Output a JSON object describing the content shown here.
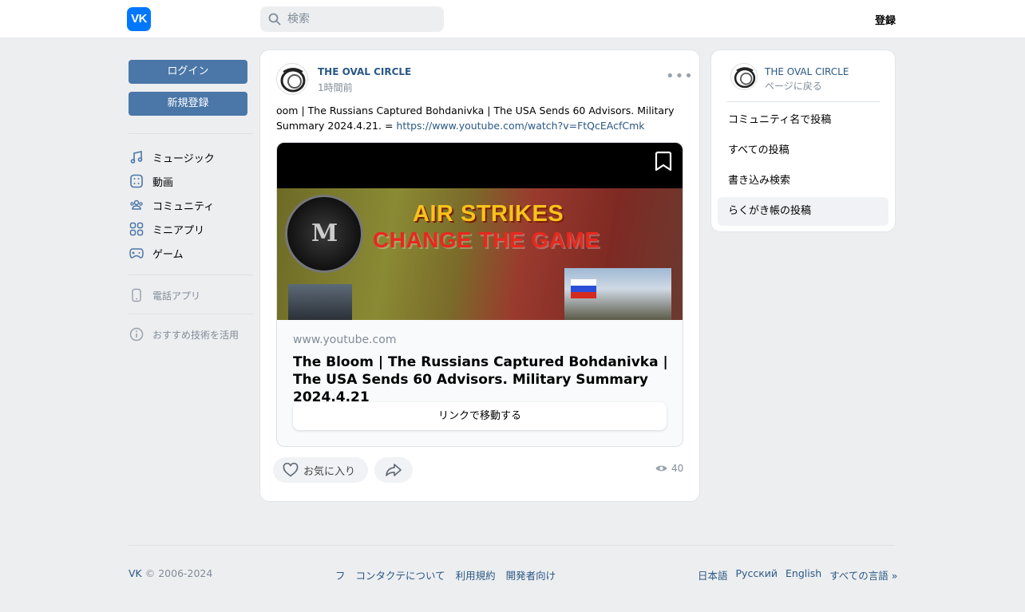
{
  "header": {
    "logo_text": "VK",
    "search_placeholder": "検索",
    "register_label": "登録"
  },
  "left_nav": {
    "login_label": "ログイン",
    "signup_label": "新規登録",
    "items": [
      {
        "label": "ミュージック",
        "icon": "music-note-icon"
      },
      {
        "label": "動画",
        "icon": "video-icon"
      },
      {
        "label": "コミュニティ",
        "icon": "community-icon"
      },
      {
        "label": "ミニアプリ",
        "icon": "mini-apps-icon"
      },
      {
        "label": "ゲーム",
        "icon": "gamepad-icon"
      }
    ],
    "phone_app_label": "電話アプリ",
    "recommend_label": "おすすめ技術を活用"
  },
  "post": {
    "author": "THE OVAL CIRCLE",
    "time": "1時間前",
    "text": "oom | The Russians Captured Bohdanivka | The USA Sends 60 Advisors. Military Summary 2024.4.21. = ",
    "link": "https://www.youtube.com/watch?v=FtQcEAcfCmk",
    "thumbnail": {
      "headline1": "AIR STRIKES",
      "headline2": "CHANGE THE GAME"
    },
    "card_domain": "www.youtube.com",
    "card_title": "The Bloom | The Russians Captured Bohdanivka | The USA Sends 60 Advisors. Military Summary 2024.4.21",
    "card_button": "リンクで移動する",
    "like_label": "お気に入り",
    "views": "40"
  },
  "side": {
    "title": "THE OVAL CIRCLE",
    "back": "ページに戻る",
    "items": [
      "コミュニティ名で投稿",
      "すべての投稿",
      "書き込み検索",
      "らくがき帳の投稿"
    ]
  },
  "footer": {
    "brand": "VK",
    "copyright": "© 2006-2024",
    "links": [
      "フ",
      "コンタクテについて",
      "利用規約",
      "開発者向け"
    ],
    "langs": [
      "日本語",
      "Русский",
      "English",
      "すべての言語 »"
    ]
  },
  "colors": {
    "accent": "#4a76a8",
    "link": "#2a5885",
    "background": "#edeef0"
  }
}
